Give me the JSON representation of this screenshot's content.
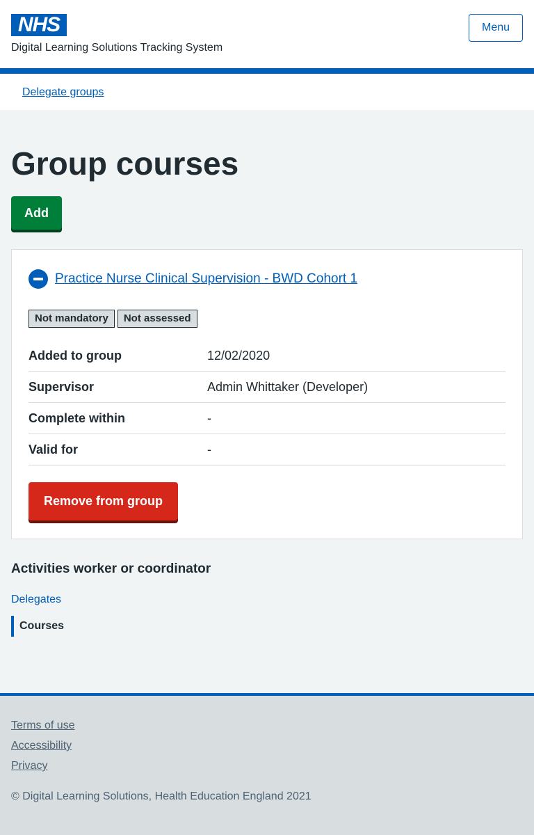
{
  "header": {
    "logo_text": "NHS",
    "service_name": "Digital Learning Solutions Tracking System",
    "menu_label": "Menu"
  },
  "breadcrumb": {
    "label": "Delegate groups"
  },
  "main": {
    "title": "Group courses",
    "add_label": "Add",
    "course": {
      "name": "Practice Nurse Clinical Supervision - BWD Cohort 1",
      "tags": [
        "Not mandatory",
        "Not assessed"
      ],
      "rows": [
        {
          "key": "Added to group",
          "value": "12/02/2020"
        },
        {
          "key": "Supervisor",
          "value": "Admin Whittaker (Developer)"
        },
        {
          "key": "Complete within",
          "value": "-"
        },
        {
          "key": "Valid for",
          "value": "-"
        }
      ],
      "remove_label": "Remove from group"
    }
  },
  "side_nav": {
    "title": "Activities worker or coordinator",
    "link": "Delegates",
    "current": "Courses"
  },
  "footer": {
    "links": [
      "Terms of use",
      "Accessibility",
      "Privacy"
    ],
    "copyright": "© Digital Learning Solutions, Health Education England 2021"
  },
  "colors": {
    "nhs_blue": "#005eb8",
    "add_green": "#007f3b",
    "remove_red": "#d5281b"
  }
}
